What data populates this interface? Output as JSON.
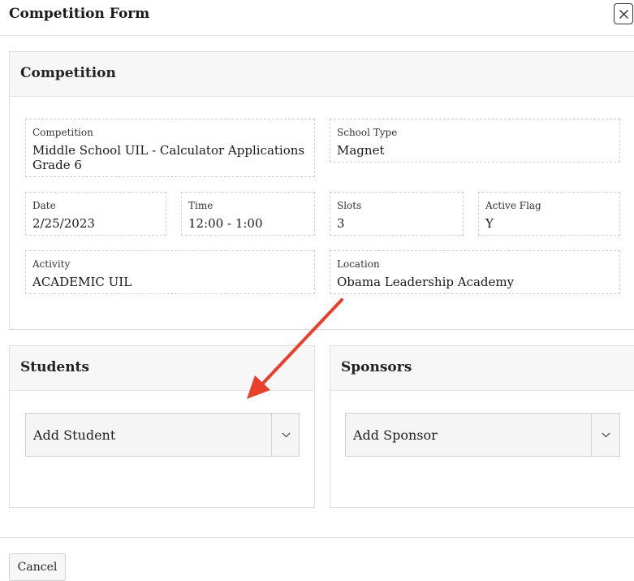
{
  "modal": {
    "title": "Competition Form"
  },
  "competition_card": {
    "title": "Competition",
    "fields": {
      "competition": {
        "label": "Competition",
        "value": "Middle School UIL - Calculator Applications Grade 6"
      },
      "school_type": {
        "label": "School Type",
        "value": "Magnet"
      },
      "date": {
        "label": "Date",
        "value": "2/25/2023"
      },
      "time": {
        "label": "Time",
        "value": "12:00 - 1:00"
      },
      "slots": {
        "label": "Slots",
        "value": "3"
      },
      "active_flag": {
        "label": "Active Flag",
        "value": "Y"
      },
      "activity": {
        "label": "Activity",
        "value": "ACADEMIC UIL"
      },
      "location": {
        "label": "Location",
        "value": "Obama Leadership Academy"
      }
    }
  },
  "students_card": {
    "title": "Students",
    "select_placeholder": "Add Student"
  },
  "sponsors_card": {
    "title": "Sponsors",
    "select_placeholder": "Add Sponsor"
  },
  "footer": {
    "cancel_label": "Cancel"
  },
  "colors": {
    "annotation_arrow": "#e8402a"
  },
  "icons": {
    "close": "close-icon",
    "chevron": "chevron-down-icon"
  }
}
